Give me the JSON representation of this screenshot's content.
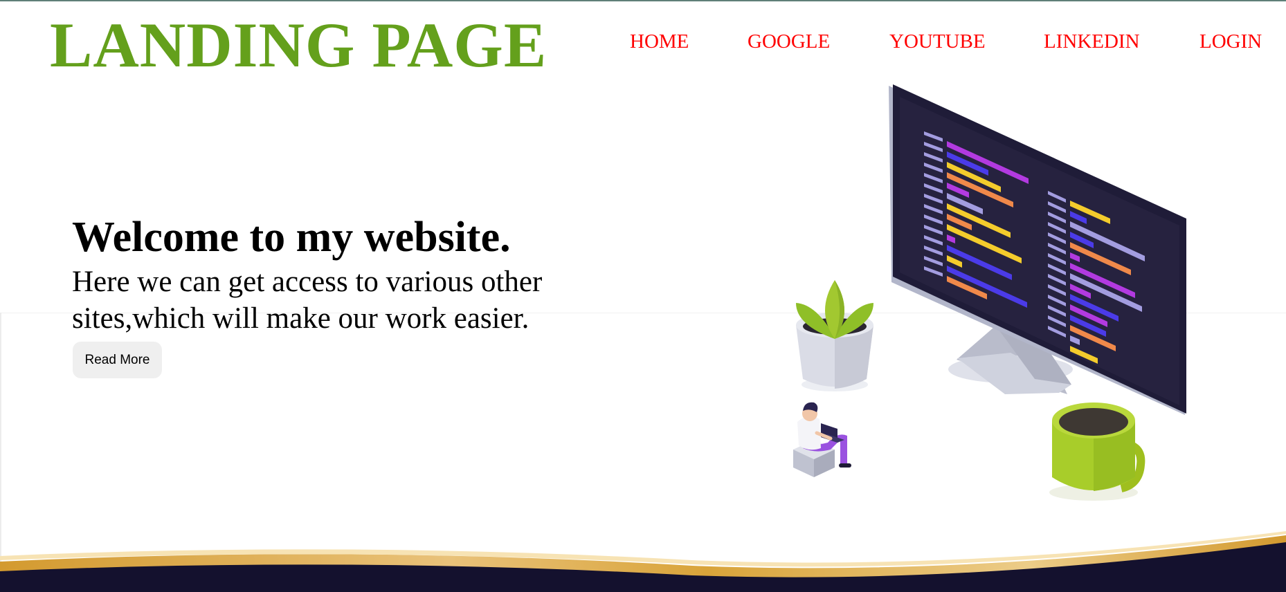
{
  "header": {
    "logo_text": "LANDING PAGE",
    "nav_items": [
      {
        "label": "HOME"
      },
      {
        "label": "GOOGLE"
      },
      {
        "label": "YOUTUBE"
      },
      {
        "label": "LINKEDIN"
      },
      {
        "label": "LOGIN"
      }
    ]
  },
  "hero": {
    "title": "Welcome to my website.",
    "text": "Here we can get access to various other sites,which will make our work easier.",
    "button_label": "Read More"
  },
  "illustration": {
    "icons": [
      "monitor-code-icon",
      "plant-pot-icon",
      "coffee-mug-icon",
      "person-laptop-icon"
    ]
  },
  "colors": {
    "logo": "#64a01c",
    "nav_link": "#ff0000",
    "wave_dark": "#14112e",
    "wave_gold": "#d9a43a"
  }
}
